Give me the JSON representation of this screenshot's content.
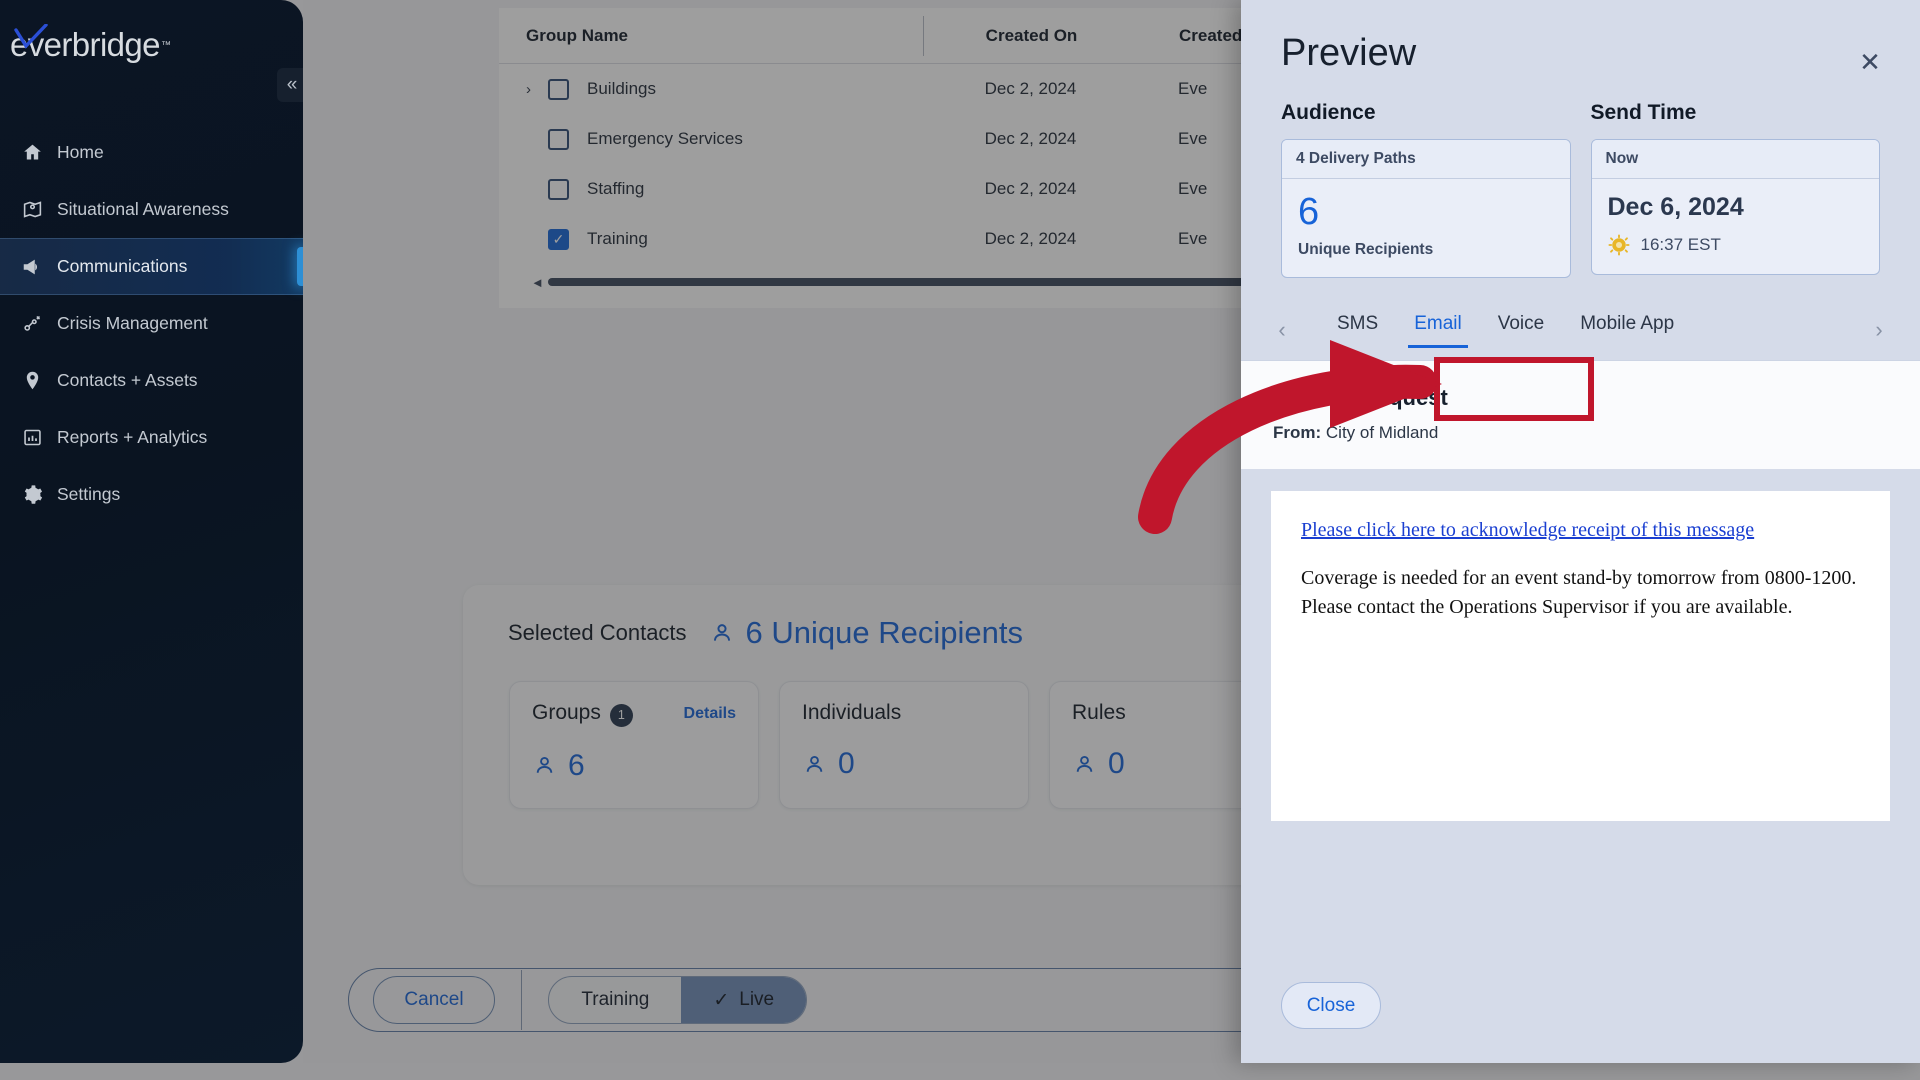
{
  "sidebar": {
    "logo_text": "everbridge",
    "logo_tm": "™",
    "collapse_label": "«",
    "items": [
      {
        "label": "Home",
        "icon": "home-icon"
      },
      {
        "label": "Situational Awareness",
        "icon": "map-pin-icon"
      },
      {
        "label": "Communications",
        "icon": "megaphone-icon"
      },
      {
        "label": "Crisis Management",
        "icon": "network-icon"
      },
      {
        "label": "Contacts + Assets",
        "icon": "location-icon"
      },
      {
        "label": "Reports + Analytics",
        "icon": "chart-icon"
      },
      {
        "label": "Settings",
        "icon": "gear-icon"
      }
    ]
  },
  "table": {
    "columns": [
      "Group Name",
      "Created On",
      "Created By"
    ],
    "rows": [
      {
        "name": "Buildings",
        "created_on": "Dec 2, 2024",
        "created_by": "Eve",
        "checked": false,
        "expandable": true
      },
      {
        "name": "Emergency Services",
        "created_on": "Dec 2, 2024",
        "created_by": "Eve",
        "checked": false,
        "expandable": false
      },
      {
        "name": "Staffing",
        "created_on": "Dec 2, 2024",
        "created_by": "Eve",
        "checked": false,
        "expandable": false
      },
      {
        "name": "Training",
        "created_on": "Dec 2, 2024",
        "created_by": "Eve",
        "checked": true,
        "expandable": false
      }
    ]
  },
  "contacts": {
    "title": "Selected Contacts",
    "unique_recipients": "6 Unique Recipients",
    "cards": [
      {
        "label": "Groups",
        "badge": "1",
        "link": "Details",
        "count": "6"
      },
      {
        "label": "Individuals",
        "badge": "",
        "link": "",
        "count": "0"
      },
      {
        "label": "Rules",
        "badge": "",
        "link": "",
        "count": "0"
      }
    ]
  },
  "bottom_bar": {
    "cancel_label": "Cancel",
    "mode_options": [
      "Training",
      "Live"
    ],
    "mode_selected": "Live",
    "check_glyph": "✓"
  },
  "preview": {
    "title": "Preview",
    "close_icon": "✕",
    "audience": {
      "section_title": "Audience",
      "header": "4 Delivery Paths",
      "value": "6",
      "sub_label": "Unique Recipients"
    },
    "send_time": {
      "section_title": "Send Time",
      "header": "Now",
      "date": "Dec 6, 2024",
      "time": "16:37 EST"
    },
    "tabs": {
      "prev_icon": "‹",
      "next_icon": "›",
      "items": [
        {
          "label": "SMS",
          "active": false
        },
        {
          "label": "Email",
          "active": true
        },
        {
          "label": "Voice",
          "active": false
        },
        {
          "label": "Mobile App",
          "active": false
        }
      ]
    },
    "message": {
      "subject": "Staffing Request",
      "from_label": "From:",
      "from_value": "City of Midland",
      "ack_link": "Please click here to acknowledge receipt of this message",
      "body": "Coverage is needed for an event stand-by tomorrow from 0800-1200. Please contact the Operations Supervisor if you are available."
    },
    "close_button": "Close"
  },
  "colors": {
    "accent_blue": "#1763d8",
    "annotation_red": "#c0162c",
    "sidebar_dark": "#0b1524",
    "panel_bg": "#d5dbe9"
  }
}
